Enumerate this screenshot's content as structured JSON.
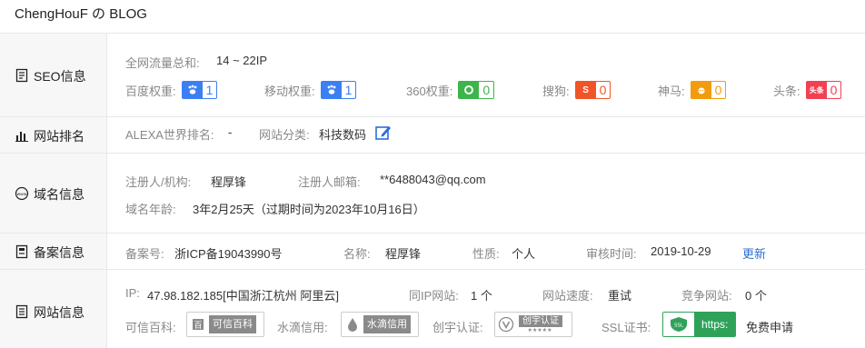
{
  "title": "ChengHouF の BLOG",
  "seo": {
    "section_label": "SEO信息",
    "traffic_label": "全网流量总和:",
    "traffic_value": "14 ~ 22IP",
    "ranks": [
      {
        "label": "百度权重:",
        "value": "1",
        "icon": "baidu-paw-icon",
        "color": "#3c7ff2"
      },
      {
        "label": "移动权重:",
        "value": "1",
        "icon": "baidu-mobile-paw-icon",
        "color": "#3c7ff2"
      },
      {
        "label": "360权重:",
        "value": "0",
        "icon": "360-icon",
        "color": "#3db54a"
      },
      {
        "label": "搜狗:",
        "value": "0",
        "icon": "sogou-icon",
        "color": "#f0552a"
      },
      {
        "label": "神马:",
        "value": "0",
        "icon": "shenma-icon",
        "color": "#f29b0c"
      },
      {
        "label": "头条:",
        "value": "0",
        "icon": "toutiao-icon",
        "color": "#f04152"
      }
    ]
  },
  "ranking": {
    "section_label": "网站排名",
    "alexa_label": "ALEXA世界排名:",
    "alexa_value": "-",
    "category_label": "网站分类:",
    "category_value": "科技数码"
  },
  "domain": {
    "section_label": "域名信息",
    "registrant_label": "注册人/机构:",
    "registrant_value": "程厚锋",
    "email_label": "注册人邮箱:",
    "email_value": "**6488043@qq.com",
    "age_label": "域名年龄:",
    "age_value": "3年2月25天（过期时间为2023年10月16日）"
  },
  "icp": {
    "section_label": "备案信息",
    "number_label": "备案号:",
    "number_value": "浙ICP备19043990号",
    "name_label": "名称:",
    "name_value": "程厚锋",
    "nature_label": "性质:",
    "nature_value": "个人",
    "review_label": "审核时间:",
    "review_value": "2019-10-29",
    "update_link": "更新"
  },
  "site": {
    "section_label": "网站信息",
    "ip_label": "IP:",
    "ip_value": "47.98.182.185[中国浙江杭州 阿里云]",
    "same_ip_label": "同IP网站:",
    "same_ip_value": "1 个",
    "speed_label": "网站速度:",
    "speed_value": "重试",
    "competitor_label": "竞争网站:",
    "competitor_value": "0 个",
    "baike_label": "可信百科:",
    "baike_badge": "可信百科",
    "shuidi_label": "水滴信用:",
    "shuidi_badge": "水滴信用",
    "chuangyu_label": "创宇认证:",
    "chuangyu_badge": "创宇认证",
    "chuangyu_stars": "★★★★★",
    "ssl_label": "SSL证书:",
    "ssl_icon_text": "SSL",
    "ssl_badge": "https:",
    "ssl_apply": "免费申请"
  }
}
